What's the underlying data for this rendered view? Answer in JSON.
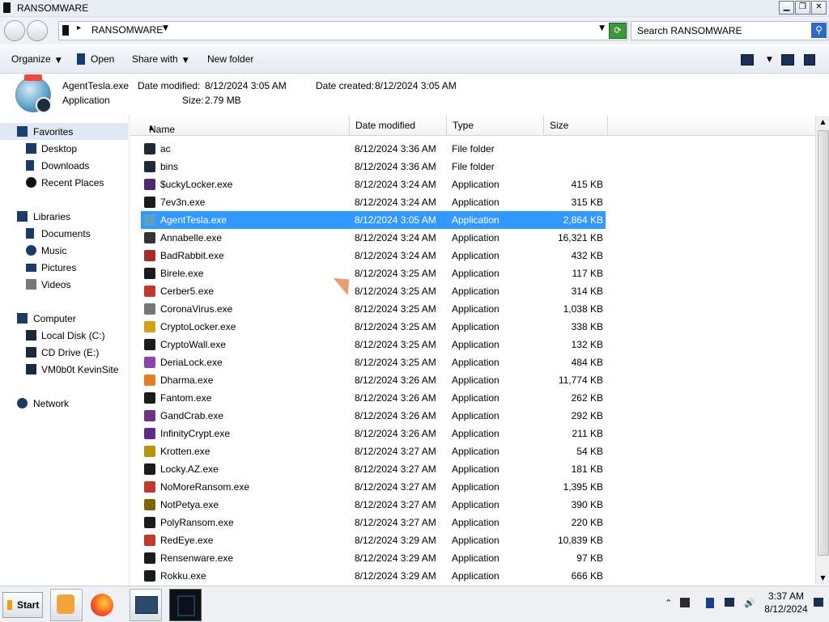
{
  "window": {
    "title": "RANSOMWARE",
    "minimize": "▁",
    "maximize": "❐",
    "close": "✕"
  },
  "address": {
    "crumb": "RANSOMWARE",
    "search_placeholder": "Search RANSOMWARE"
  },
  "toolbar": {
    "organize": "Organize",
    "open": "Open",
    "share_with": "Share with",
    "new_folder": "New folder"
  },
  "details": {
    "file_name": "AgentTesla.exe",
    "file_type": "Application",
    "date_modified_label": "Date modified:",
    "date_modified": "8/12/2024 3:05 AM",
    "date_created_label": "Date created:",
    "date_created": "8/12/2024 3:05 AM",
    "size_label": "Size:",
    "size": "2.79 MB"
  },
  "nav": {
    "favorites": "Favorites",
    "desktop": "Desktop",
    "downloads": "Downloads",
    "recent_places": "Recent Places",
    "libraries": "Libraries",
    "documents": "Documents",
    "music": "Music",
    "pictures": "Pictures",
    "videos": "Videos",
    "computer": "Computer",
    "local_disk": "Local Disk (C:)",
    "cd_drive": "CD Drive (E:)",
    "vmshare": "VM0b0t KevinSite",
    "network": "Network"
  },
  "columns": {
    "name": "Name",
    "date_modified": "Date modified",
    "type": "Type",
    "size": "Size"
  },
  "files": [
    {
      "name": "ac",
      "date": "8/12/2024 3:36 AM",
      "type": "File folder",
      "size": ""
    },
    {
      "name": "bins",
      "date": "8/12/2024 3:36 AM",
      "type": "File folder",
      "size": ""
    },
    {
      "name": "$uckyLocker.exe",
      "date": "8/12/2024 3:24 AM",
      "type": "Application",
      "size": "415 KB"
    },
    {
      "name": "7ev3n.exe",
      "date": "8/12/2024 3:24 AM",
      "type": "Application",
      "size": "315 KB"
    },
    {
      "name": "AgentTesla.exe",
      "date": "8/12/2024 3:05 AM",
      "type": "Application",
      "size": "2,864 KB"
    },
    {
      "name": "Annabelle.exe",
      "date": "8/12/2024 3:24 AM",
      "type": "Application",
      "size": "16,321 KB"
    },
    {
      "name": "BadRabbit.exe",
      "date": "8/12/2024 3:24 AM",
      "type": "Application",
      "size": "432 KB"
    },
    {
      "name": "Birele.exe",
      "date": "8/12/2024 3:25 AM",
      "type": "Application",
      "size": "117 KB"
    },
    {
      "name": "Cerber5.exe",
      "date": "8/12/2024 3:25 AM",
      "type": "Application",
      "size": "314 KB"
    },
    {
      "name": "CoronaVirus.exe",
      "date": "8/12/2024 3:25 AM",
      "type": "Application",
      "size": "1,038 KB"
    },
    {
      "name": "CryptoLocker.exe",
      "date": "8/12/2024 3:25 AM",
      "type": "Application",
      "size": "338 KB"
    },
    {
      "name": "CryptoWall.exe",
      "date": "8/12/2024 3:25 AM",
      "type": "Application",
      "size": "132 KB"
    },
    {
      "name": "DeriaLock.exe",
      "date": "8/12/2024 3:25 AM",
      "type": "Application",
      "size": "484 KB"
    },
    {
      "name": "Dharma.exe",
      "date": "8/12/2024 3:26 AM",
      "type": "Application",
      "size": "11,774 KB"
    },
    {
      "name": "Fantom.exe",
      "date": "8/12/2024 3:26 AM",
      "type": "Application",
      "size": "262 KB"
    },
    {
      "name": "GandCrab.exe",
      "date": "8/12/2024 3:26 AM",
      "type": "Application",
      "size": "292 KB"
    },
    {
      "name": "InfinityCrypt.exe",
      "date": "8/12/2024 3:26 AM",
      "type": "Application",
      "size": "211 KB"
    },
    {
      "name": "Krotten.exe",
      "date": "8/12/2024 3:27 AM",
      "type": "Application",
      "size": "54 KB"
    },
    {
      "name": "Locky.AZ.exe",
      "date": "8/12/2024 3:27 AM",
      "type": "Application",
      "size": "181 KB"
    },
    {
      "name": "NoMoreRansom.exe",
      "date": "8/12/2024 3:27 AM",
      "type": "Application",
      "size": "1,395 KB"
    },
    {
      "name": "NotPetya.exe",
      "date": "8/12/2024 3:27 AM",
      "type": "Application",
      "size": "390 KB"
    },
    {
      "name": "PolyRansom.exe",
      "date": "8/12/2024 3:27 AM",
      "type": "Application",
      "size": "220 KB"
    },
    {
      "name": "RedEye.exe",
      "date": "8/12/2024 3:29 AM",
      "type": "Application",
      "size": "10,839 KB"
    },
    {
      "name": "Rensenware.exe",
      "date": "8/12/2024 3:29 AM",
      "type": "Application",
      "size": "97 KB"
    },
    {
      "name": "Rokku.exe",
      "date": "8/12/2024 3:29 AM",
      "type": "Application",
      "size": "666 KB"
    }
  ],
  "taskbar": {
    "start": "Start",
    "time": "3:37 AM",
    "date": "8/12/2024"
  },
  "colors": {
    "selection": "#3399ff",
    "title_bg": "#e9eef5",
    "nav_selected": "#dfe8f3"
  }
}
